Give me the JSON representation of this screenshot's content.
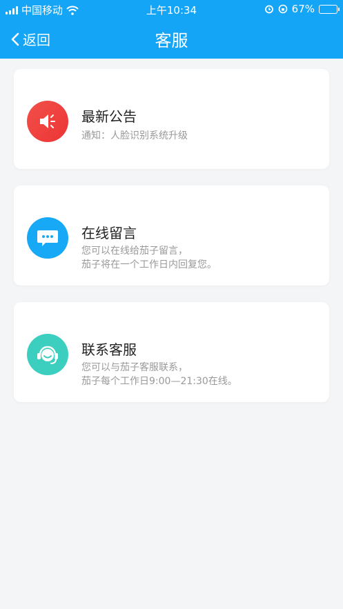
{
  "status_bar": {
    "carrier": "中国移动",
    "time": "上午10:34",
    "battery": "67%",
    "battery_level": 0.67
  },
  "nav": {
    "back_label": "返回",
    "title": "客服"
  },
  "cards": [
    {
      "title": "最新公告",
      "lines": [
        "通知：人脸识别系统升级"
      ],
      "icon": "speaker-icon",
      "color": "#ef4343"
    },
    {
      "title": "在线留言",
      "lines": [
        "您可以在线给茄子留言，",
        "茄子将在一个工作日内回复您。"
      ],
      "icon": "chat-bubble-icon",
      "color": "#17a9f6"
    },
    {
      "title": "联系客服",
      "lines": [
        "您可以与茄子客服联系，",
        "茄子每个工作日9:00—21:30在线。"
      ],
      "icon": "headset-icon",
      "color": "#3ccfc0"
    }
  ]
}
